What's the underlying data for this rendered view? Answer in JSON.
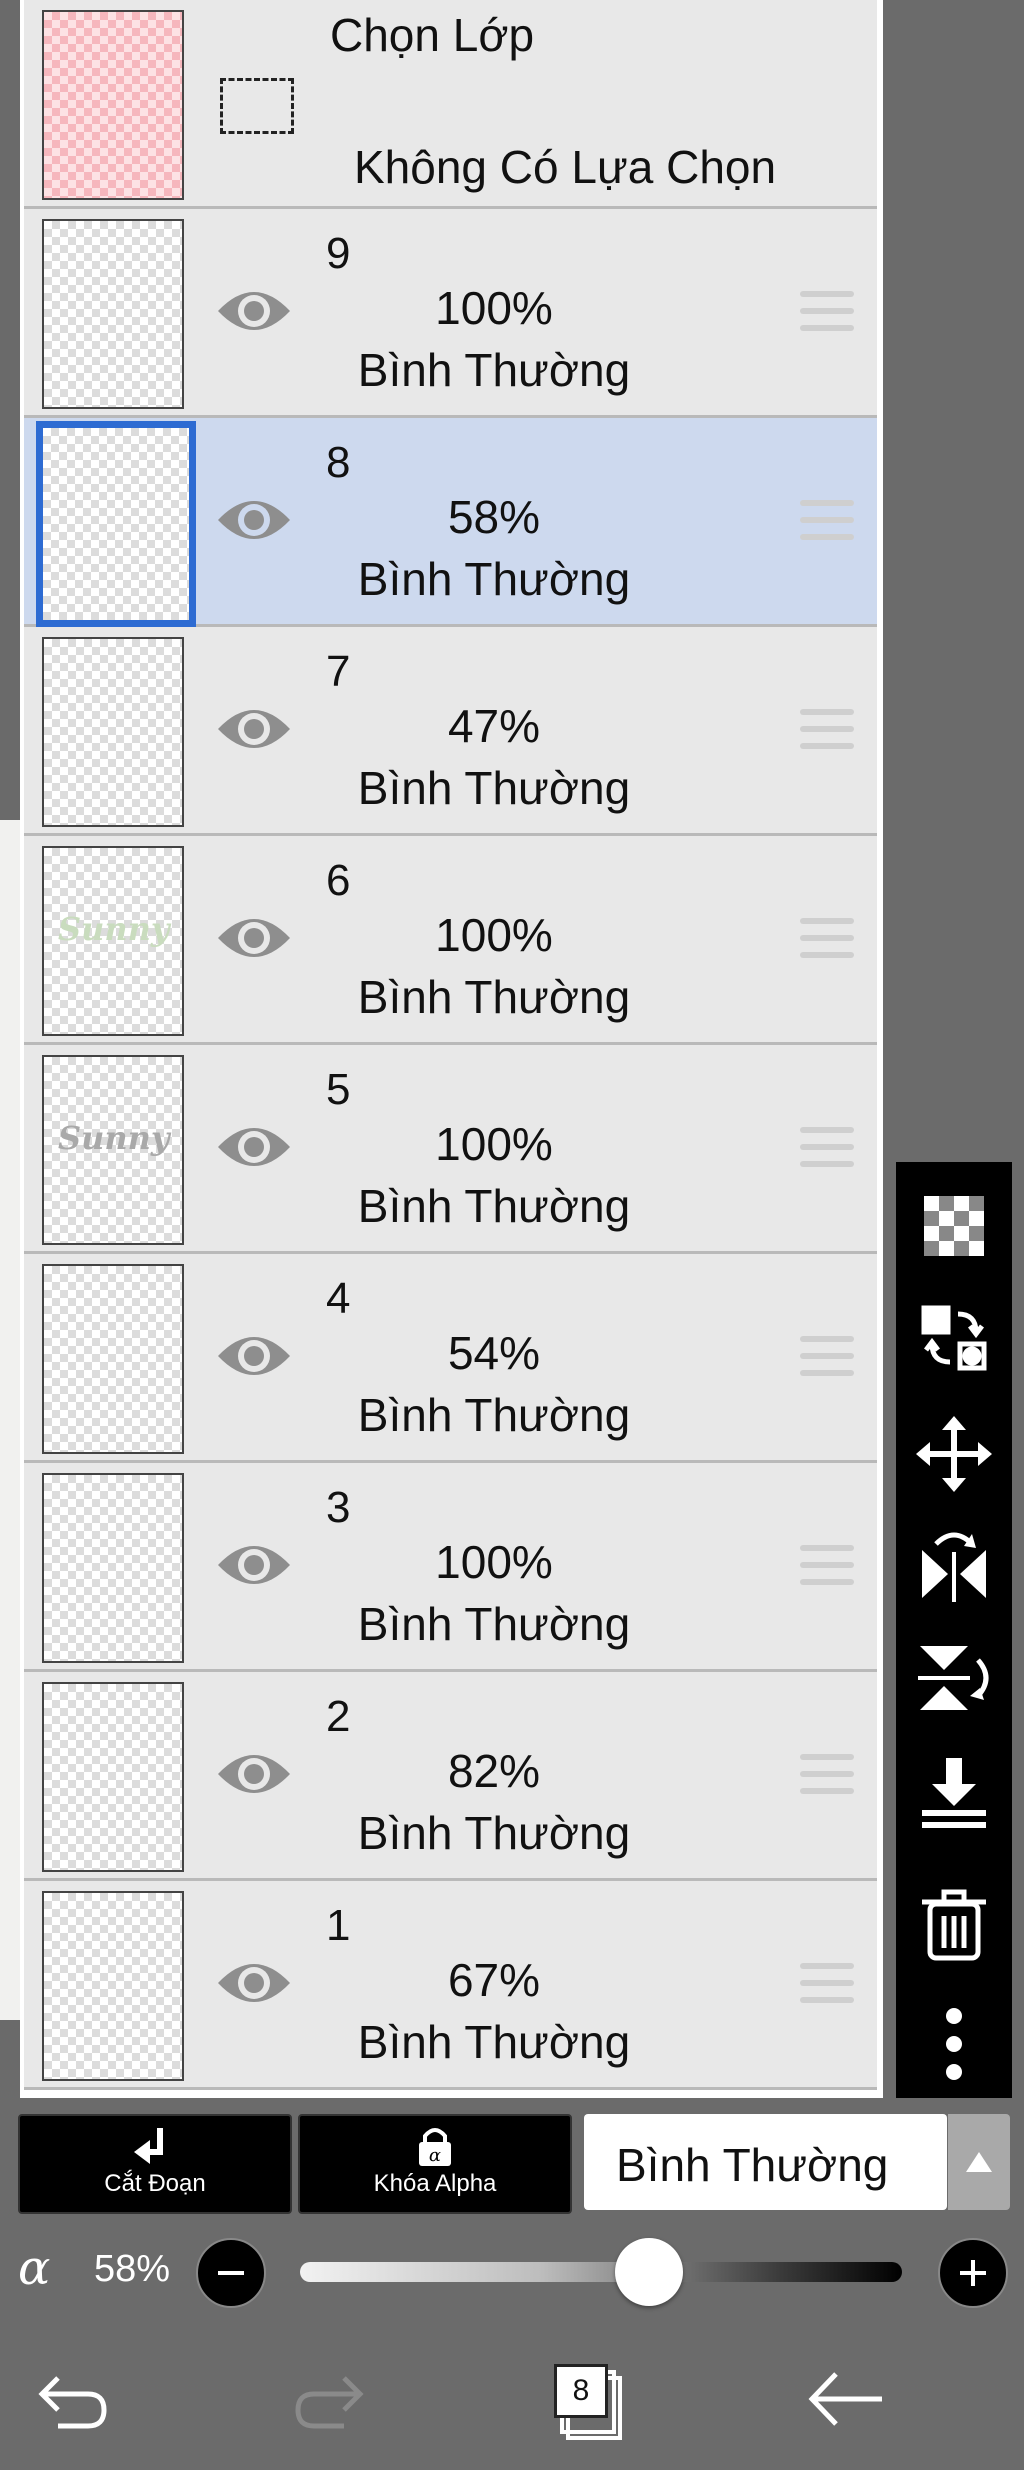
{
  "selection_layer": {
    "title": "Chọn Lớp",
    "subtitle": "Không Có Lựa Chọn"
  },
  "layers": [
    {
      "number": "9",
      "opacity": "100%",
      "mode": "Bình Thường",
      "selected": false
    },
    {
      "number": "8",
      "opacity": "58%",
      "mode": "Bình Thường",
      "selected": true
    },
    {
      "number": "7",
      "opacity": "47%",
      "mode": "Bình Thường",
      "selected": false
    },
    {
      "number": "6",
      "opacity": "100%",
      "mode": "Bình Thường",
      "selected": false,
      "thumb_text": "Sunny"
    },
    {
      "number": "5",
      "opacity": "100%",
      "mode": "Bình Thường",
      "selected": false,
      "thumb_text": "Sunny"
    },
    {
      "number": "4",
      "opacity": "54%",
      "mode": "Bình Thường",
      "selected": false
    },
    {
      "number": "3",
      "opacity": "100%",
      "mode": "Bình Thường",
      "selected": false
    },
    {
      "number": "2",
      "opacity": "82%",
      "mode": "Bình Thường",
      "selected": false
    },
    {
      "number": "1",
      "opacity": "67%",
      "mode": "Bình Thường",
      "selected": false
    }
  ],
  "toolbar": {
    "tools": [
      "checkerboard-icon",
      "swap-layer-icon",
      "move-icon",
      "flip-horizontal-icon",
      "flip-vertical-icon",
      "merge-down-icon",
      "trash-icon",
      "more-icon"
    ]
  },
  "controls": {
    "clip_label": "Cắt Đoạn",
    "alpha_lock_label": "Khóa Alpha",
    "blend_mode": "Bình Thường",
    "alpha_symbol": "α",
    "opacity_value": "58%",
    "opacity_fraction": 0.58
  },
  "navbar": {
    "layer_count_badge": "8"
  },
  "colors": {
    "selected_row": "#cdd9ee",
    "selected_border": "#2d6bd2",
    "row_bg": "#e8e8e8",
    "toolbar_bg": "#000000"
  }
}
